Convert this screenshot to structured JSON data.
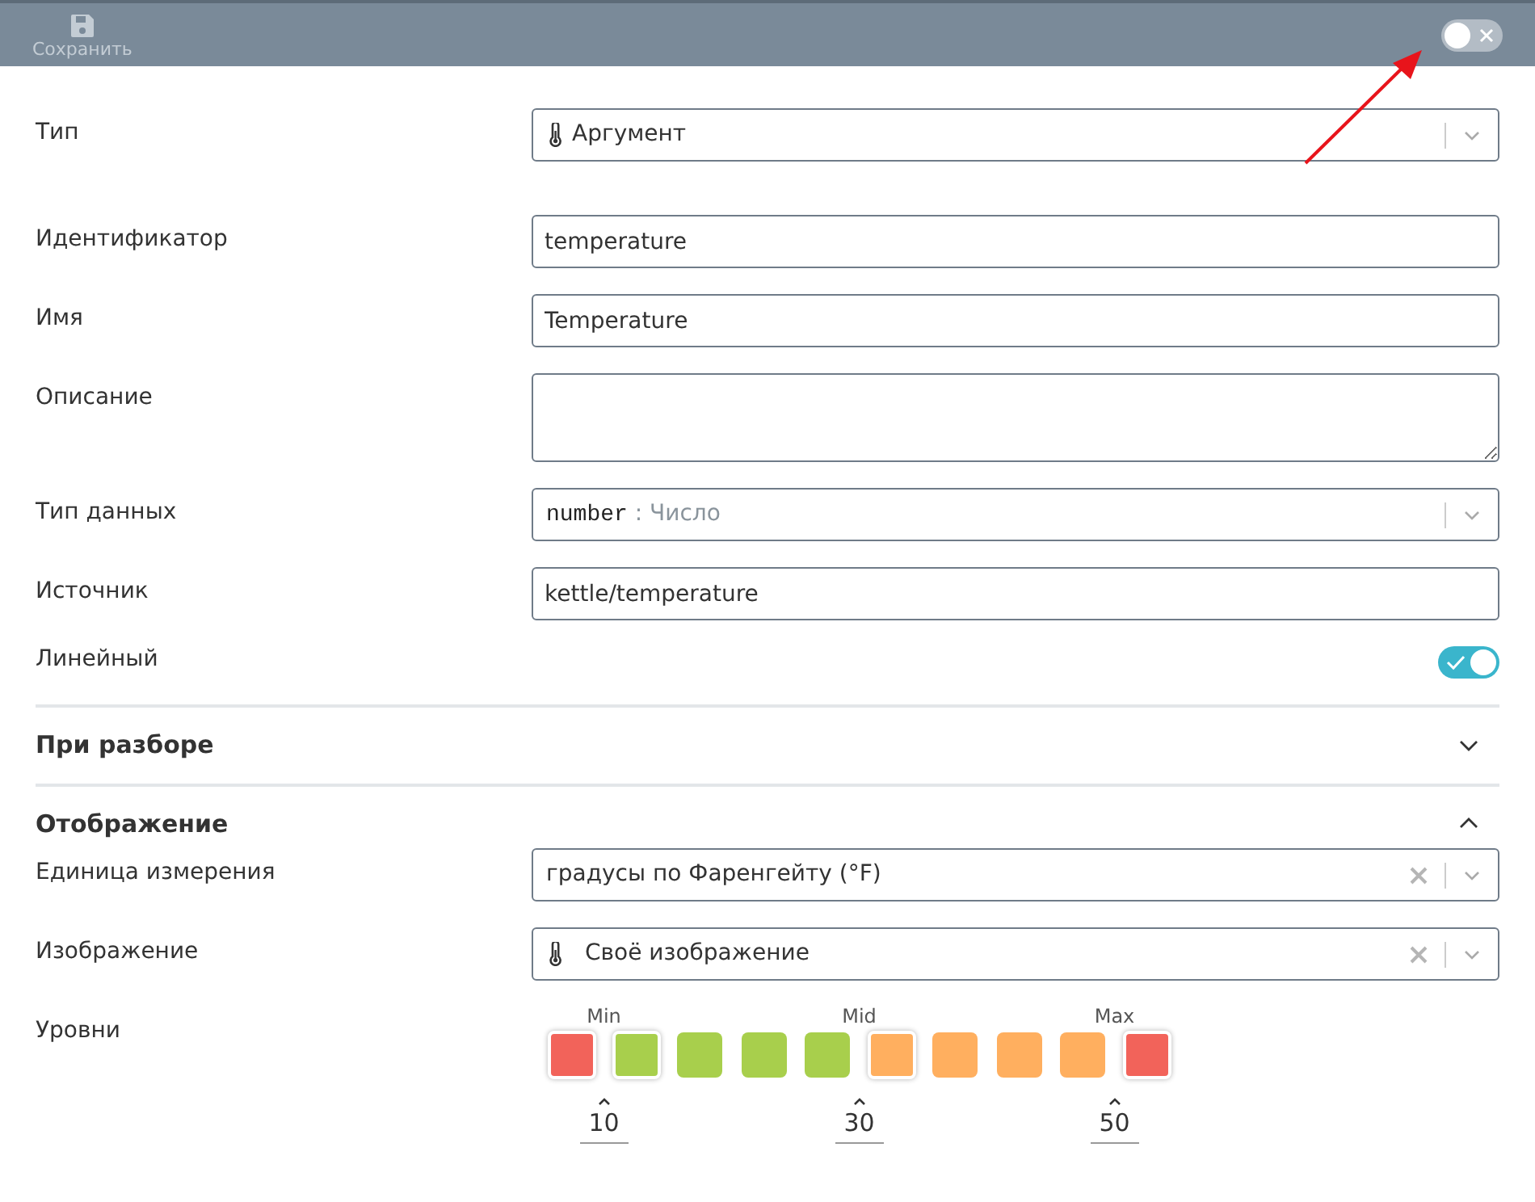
{
  "toolbar": {
    "save_button": {
      "label": "Сохранить",
      "disabled": true
    },
    "toggle": {
      "on": false
    }
  },
  "fields": [
    {
      "kind": "select",
      "label": "Тип",
      "value": "Аргумент",
      "with_icon": true,
      "clearable": false
    },
    {
      "kind": "input",
      "label": "Идентификатор",
      "value": "temperature"
    },
    {
      "kind": "input",
      "label": "Имя",
      "value": "Temperature"
    },
    {
      "kind": "textarea",
      "label": "Описание"
    },
    {
      "kind": "typed-select",
      "label": "Тип данных",
      "code": "number",
      "hint": ": Число"
    },
    {
      "kind": "input",
      "label": "Источник",
      "value": "kettle/temperature"
    },
    {
      "kind": "toggle",
      "label": "Линейный",
      "on": true
    }
  ],
  "sections": [
    {
      "title": "При разборе",
      "expanded": false
    },
    {
      "title": "Отображение",
      "expanded": true,
      "fields": [
        {
          "kind": "select",
          "label": "Единица измерения",
          "value": "градусы по Фаренгейту (°F)",
          "with_icon": false,
          "clearable": true
        },
        {
          "kind": "select",
          "label": "Изображение",
          "value": "Своё изображение",
          "with_icon": true,
          "clearable": true
        }
      ],
      "levels": {
        "label": "Уровни",
        "squares": [
          {
            "color": "#f2635a",
            "marked": true,
            "threshold": {
              "label": "Min",
              "value": "10"
            }
          },
          {
            "color": "#a8cf4c",
            "marked": true
          },
          {
            "color": "#a8cf4c",
            "marked": false
          },
          {
            "color": "#a8cf4c",
            "marked": false
          },
          {
            "color": "#a8cf4c",
            "marked": false,
            "threshold": {
              "label": "Mid",
              "value": "30"
            }
          },
          {
            "color": "#ffaf5f",
            "marked": true
          },
          {
            "color": "#ffaf5f",
            "marked": false
          },
          {
            "color": "#ffaf5f",
            "marked": false
          },
          {
            "color": "#ffaf5f",
            "marked": false,
            "threshold": {
              "label": "Max",
              "value": "50"
            }
          },
          {
            "color": "#f2635a",
            "marked": true
          }
        ]
      }
    }
  ]
}
